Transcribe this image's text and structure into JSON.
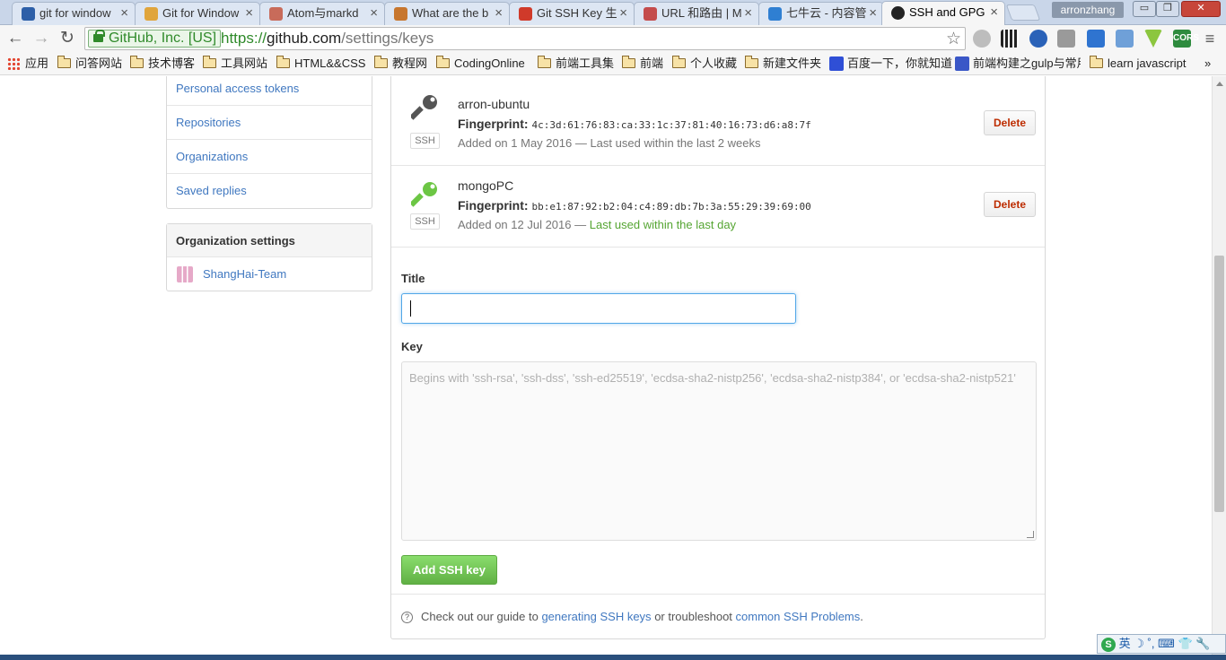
{
  "browser": {
    "tabs": [
      {
        "label": "git for window",
        "color": "#2d5fa8"
      },
      {
        "label": "Git for Window",
        "color": "#e0a53c"
      },
      {
        "label": "Atom与markd",
        "color": "#c86b5a"
      },
      {
        "label": "What are the b",
        "color": "#c7762e"
      },
      {
        "label": "Git SSH Key 生",
        "color": "#d03a2a"
      },
      {
        "label": "URL 和路由 | M",
        "color": "#c44c4c"
      },
      {
        "label": "七牛云 - 内容管",
        "color": "#2f7fd2"
      },
      {
        "label": "SSH and GPG",
        "color": "#222222"
      }
    ],
    "profile_name": "arronzhang",
    "window_minimize": "▭",
    "window_maximize": "❐",
    "window_close": "✕",
    "tab_close": "×",
    "nav_back": "←",
    "nav_forward": "→",
    "nav_reload": "↻",
    "security_label": "GitHub, Inc. [US]",
    "url_scheme": "https://",
    "url_host": "github.com",
    "url_path": "/settings/keys",
    "bookmark_star": "☆",
    "extensions": [
      "m-icon",
      "qr-icon",
      "moon-icon",
      "w-icon",
      "pocket-icon",
      "screenshot-icon",
      "vue-icon",
      "cors-icon",
      "menu-icon"
    ],
    "cors_label": "CORS",
    "menu_glyph": "≡"
  },
  "bookmarks": [
    {
      "label": "应用",
      "type": "apps"
    },
    {
      "label": "问答网站",
      "type": "folder"
    },
    {
      "label": "技术博客",
      "type": "folder"
    },
    {
      "label": "工具网站",
      "type": "folder"
    },
    {
      "label": "HTML&&CSS",
      "type": "folder"
    },
    {
      "label": "教程网",
      "type": "folder"
    },
    {
      "label": "CodingOnline",
      "type": "folder"
    },
    {
      "label": "前端工具集",
      "type": "folder"
    },
    {
      "label": "前端",
      "type": "folder"
    },
    {
      "label": "个人收藏",
      "type": "folder"
    },
    {
      "label": "新建文件夹",
      "type": "folder"
    },
    {
      "label": "百度一下，你就知道",
      "type": "site"
    },
    {
      "label": "前端构建之gulp与常用",
      "type": "site"
    },
    {
      "label": "learn javascript",
      "type": "folder"
    }
  ],
  "bookmarks_more": "»",
  "sidebar": {
    "personal_items": [
      "Personal access tokens",
      "Repositories",
      "Organizations",
      "Saved replies"
    ],
    "org_heading": "Organization settings",
    "org_items": [
      "ShangHai-Team"
    ]
  },
  "keys": [
    {
      "title": "arron-ubuntu",
      "fingerprint_label": "Fingerprint:",
      "fingerprint": "4c:3d:61:76:83:ca:33:1c:37:81:40:16:73:d6:a8:7f",
      "added": "Added on 1 May 2016 —",
      "last_used": "Last used within the last 2 weeks",
      "badge": "SSH",
      "icon_color": "#555555",
      "recent": false,
      "delete_label": "Delete"
    },
    {
      "title": "mongoPC",
      "fingerprint_label": "Fingerprint:",
      "fingerprint": "bb:e1:87:92:b2:04:c4:89:db:7b:3a:55:29:39:69:00",
      "added": "Added on 12 Jul 2016 —",
      "last_used": "Last used within the last day",
      "badge": "SSH",
      "icon_color": "#6cc644",
      "recent": true,
      "delete_label": "Delete"
    }
  ],
  "form": {
    "title_label": "Title",
    "title_value": "",
    "key_label": "Key",
    "key_placeholder": "Begins with 'ssh-rsa', 'ssh-dss', 'ssh-ed25519', 'ecdsa-sha2-nistp256', 'ecdsa-sha2-nistp384', or 'ecdsa-sha2-nistp521'",
    "submit_label": "Add SSH key"
  },
  "footer": {
    "prefix": "Check out our guide to",
    "link1": "generating SSH keys",
    "middle": "or troubleshoot",
    "link2": "common SSH Problems",
    "suffix": ".",
    "help_glyph": "?"
  },
  "ime": {
    "logo": "S",
    "mode": "英",
    "extra": "☽ ˚, ⌨ 👕 🔧"
  }
}
